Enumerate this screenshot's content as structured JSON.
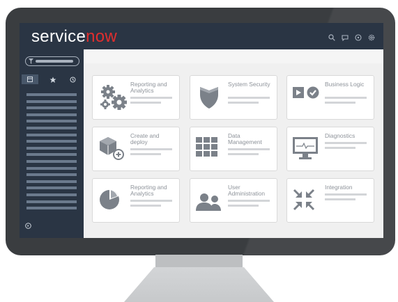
{
  "brand": {
    "name_plain": "service",
    "name_accent": "now",
    "accent_color": "#e02e2e",
    "topbar_color": "#2a3544"
  },
  "header_icons": [
    "search-icon",
    "chat-icon",
    "help-icon",
    "settings-icon"
  ],
  "sidebar": {
    "filter_icon": "filter-icon",
    "tabs": [
      "modules-tab",
      "favorites-tab",
      "history-tab"
    ],
    "item_count": 18,
    "bottom_icon": "expand-icon"
  },
  "cards": [
    {
      "title": "Reporting and Analytics",
      "icon": "gears-icon"
    },
    {
      "title": "System Security",
      "icon": "shield-icon"
    },
    {
      "title": "Business Logic",
      "icon": "play-check-icon"
    },
    {
      "title": "Create and deploy",
      "icon": "cube-add-icon"
    },
    {
      "title": "Data Management",
      "icon": "grid-icon"
    },
    {
      "title": "Diagnostics",
      "icon": "monitor-pulse-icon"
    },
    {
      "title": "Reporting and Analytics",
      "icon": "pie-chart-icon"
    },
    {
      "title": "User Administration",
      "icon": "users-icon"
    },
    {
      "title": "Integration",
      "icon": "arrows-in-icon"
    }
  ]
}
